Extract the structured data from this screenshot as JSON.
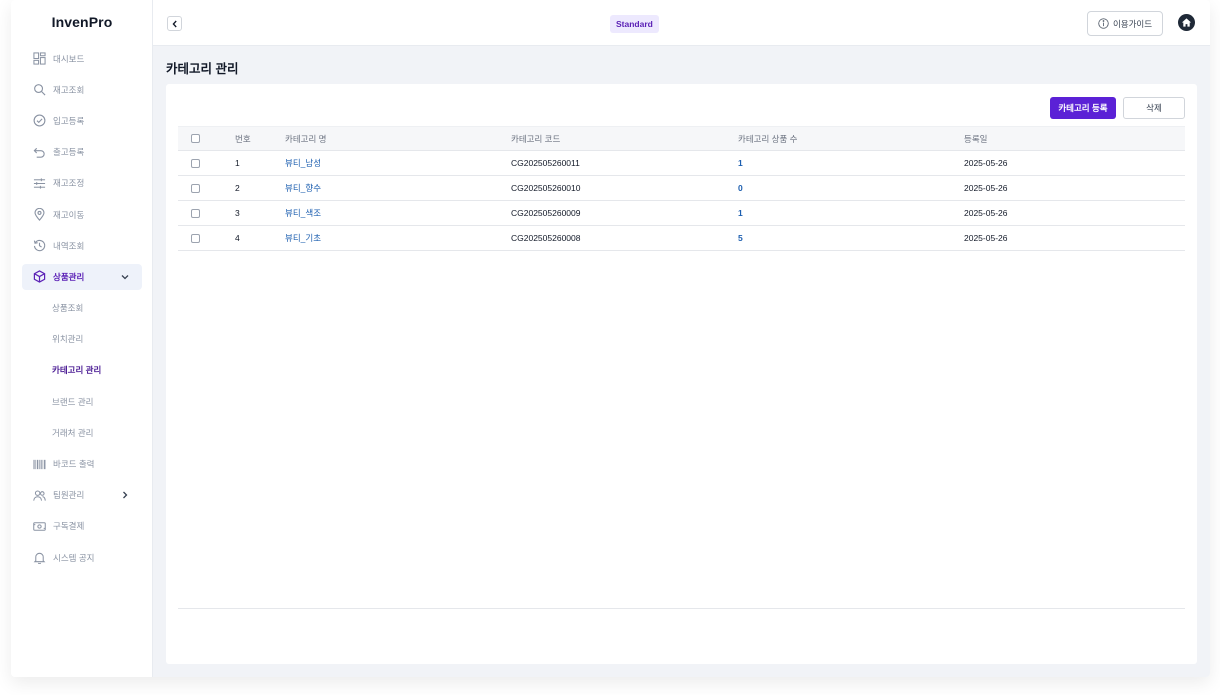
{
  "app": {
    "logo": "InvenPro"
  },
  "sidebar": {
    "items": [
      {
        "label": "대시보드",
        "icon": "dashboard-icon"
      },
      {
        "label": "재고조회",
        "icon": "search-icon"
      },
      {
        "label": "입고등록",
        "icon": "check-circle-icon"
      },
      {
        "label": "출고등록",
        "icon": "undo-icon"
      },
      {
        "label": "재고조정",
        "icon": "sliders-icon"
      },
      {
        "label": "재고이동",
        "icon": "location-pin-icon"
      },
      {
        "label": "내역조회",
        "icon": "history-icon"
      },
      {
        "label": "상품관리",
        "icon": "box-icon",
        "expanded": true
      }
    ],
    "sub_items": [
      "상품조회",
      "위치관리",
      "카테고리 관리",
      "브랜드 관리",
      "거래처 관리"
    ],
    "current_sub": "카테고리 관리",
    "items_after": [
      {
        "label": "바코드 출력",
        "icon": "barcode-icon"
      },
      {
        "label": "팀원관리",
        "icon": "users-icon"
      },
      {
        "label": "구독결제",
        "icon": "payment-icon"
      },
      {
        "label": "시스템 공지",
        "icon": "bell-icon"
      }
    ]
  },
  "header": {
    "plan": "Standard",
    "guide_label": "이용가이드"
  },
  "main": {
    "title": "카테고리 관리",
    "register_label": "카테고리 등록",
    "delete_label": "삭제",
    "columns": [
      "번호",
      "카테고리 명",
      "카테고리 코드",
      "카테고리 상품 수",
      "등록일"
    ],
    "rows": [
      {
        "no": "1",
        "name": "뷰티_남성",
        "code": "CG202505260011",
        "count": "1",
        "date": "2025-05-26"
      },
      {
        "no": "2",
        "name": "뷰티_향수",
        "code": "CG202505260010",
        "count": "0",
        "date": "2025-05-26"
      },
      {
        "no": "3",
        "name": "뷰티_색조",
        "code": "CG202505260009",
        "count": "1",
        "date": "2025-05-26"
      },
      {
        "no": "4",
        "name": "뷰티_기초",
        "code": "CG202505260008",
        "count": "5",
        "date": "2025-05-26"
      }
    ]
  },
  "colors": {
    "accent": "#5b21d6",
    "link": "#1d5fb0",
    "active_bg": "#eef2fa"
  }
}
